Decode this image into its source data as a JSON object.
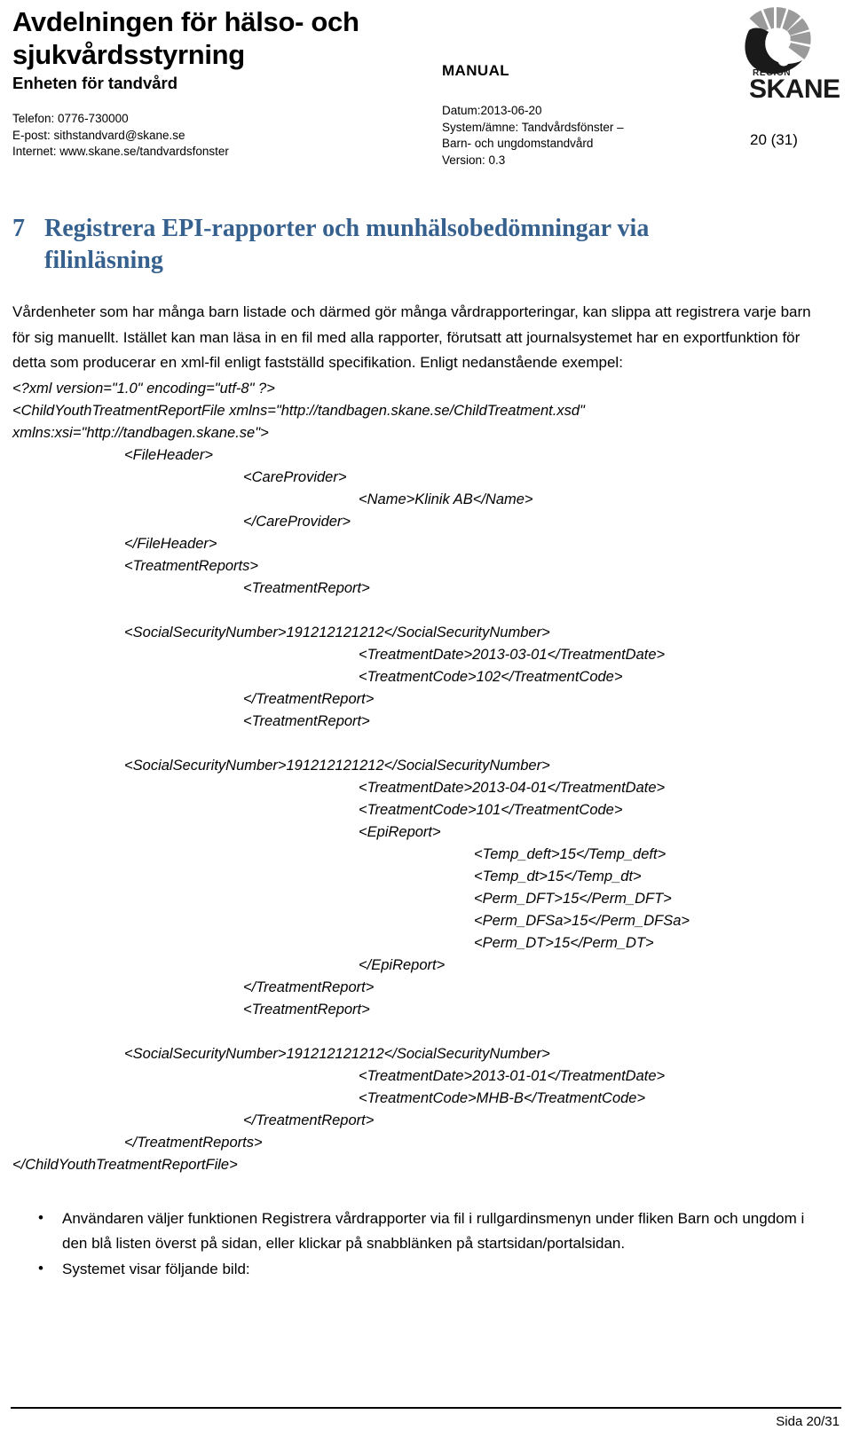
{
  "header": {
    "org_title": "Avdelningen för hälso- och sjukvårdsstyrning",
    "org_subtitle": "Enheten för tandvård",
    "contact": {
      "phone": "Telefon: 0776-730000",
      "email": "E-post: sithstandvard@skane.se",
      "internet": "Internet: www.skane.se/tandvardsfonster"
    },
    "doc_type": "MANUAL",
    "meta": {
      "date": "Datum:2013-06-20",
      "system_line1": "System/ämne: Tandvårdsfönster –",
      "system_line2": "Barn- och ungdomstandvård",
      "version": "Version: 0.3"
    },
    "page_indicator": "20 (31)",
    "logo": {
      "wordmark": "SKANE",
      "sub_wordmark": "REGION",
      "ring_color": "#9A9A9A",
      "mark_color": "#1A1A1A"
    }
  },
  "section": {
    "number": "7",
    "title": "Registrera EPI-rapporter och munhälsobedömningar via filinläsning",
    "heading_color": "#36618E",
    "paragraph": "Vårdenheter som har många barn listade och därmed gör många vårdrapporteringar, kan slippa att registrera varje barn för sig manuellt. Istället kan man läsa in en fil med alla rapporter, förutsatt att journalsystemet har en exportfunktion för detta som producerar en xml-fil enligt fastställd specifikation. Enligt nedanstående exempel:"
  },
  "xml_example": [
    {
      "indent": 0,
      "text": "<?xml version=\"1.0\" encoding=\"utf-8\" ?>"
    },
    {
      "indent": 0,
      "text": "<ChildYouthTreatmentReportFile xmlns=\"http://tandbagen.skane.se/ChildTreatment.xsd\""
    },
    {
      "indent": 0,
      "text": "xmlns:xsi=\"http://tandbagen.skane.se\">"
    },
    {
      "indent": 1,
      "text": "<FileHeader>"
    },
    {
      "indent": 2,
      "text": "<CareProvider>"
    },
    {
      "indent": 3,
      "text": "<Name>Klinik AB</Name>"
    },
    {
      "indent": 2,
      "text": "</CareProvider>"
    },
    {
      "indent": 1,
      "text": "</FileHeader>"
    },
    {
      "indent": 1,
      "text": "<TreatmentReports>"
    },
    {
      "indent": 2,
      "text": "<TreatmentReport>"
    },
    {
      "indent": 0,
      "text": ""
    },
    {
      "indent": 1,
      "text": "<SocialSecurityNumber>191212121212</SocialSecurityNumber>"
    },
    {
      "indent": 3,
      "text": "<TreatmentDate>2013-03-01</TreatmentDate>"
    },
    {
      "indent": 3,
      "text": "<TreatmentCode>102</TreatmentCode>"
    },
    {
      "indent": 2,
      "text": "</TreatmentReport>"
    },
    {
      "indent": 2,
      "text": "<TreatmentReport>"
    },
    {
      "indent": 0,
      "text": ""
    },
    {
      "indent": 1,
      "text": "<SocialSecurityNumber>191212121212</SocialSecurityNumber>"
    },
    {
      "indent": 3,
      "text": "<TreatmentDate>2013-04-01</TreatmentDate>"
    },
    {
      "indent": 3,
      "text": "<TreatmentCode>101</TreatmentCode>"
    },
    {
      "indent": 3,
      "text": "<EpiReport>"
    },
    {
      "indent": 4,
      "text": "<Temp_deft>15</Temp_deft>"
    },
    {
      "indent": 4,
      "text": "<Temp_dt>15</Temp_dt>"
    },
    {
      "indent": 4,
      "text": "<Perm_DFT>15</Perm_DFT>"
    },
    {
      "indent": 4,
      "text": "<Perm_DFSa>15</Perm_DFSa>"
    },
    {
      "indent": 4,
      "text": "<Perm_DT>15</Perm_DT>"
    },
    {
      "indent": 3,
      "text": "</EpiReport>"
    },
    {
      "indent": 2,
      "text": "</TreatmentReport>"
    },
    {
      "indent": 2,
      "text": "<TreatmentReport>"
    },
    {
      "indent": 0,
      "text": ""
    },
    {
      "indent": 1,
      "text": "<SocialSecurityNumber>191212121212</SocialSecurityNumber>"
    },
    {
      "indent": 3,
      "text": "<TreatmentDate>2013-01-01</TreatmentDate>"
    },
    {
      "indent": 3,
      "text": "<TreatmentCode>MHB-B</TreatmentCode>"
    },
    {
      "indent": 2,
      "text": "</TreatmentReport>"
    },
    {
      "indent": 1,
      "text": "</TreatmentReports>"
    },
    {
      "indent": 0,
      "text": "</ChildYouthTreatmentReportFile>"
    }
  ],
  "bullets": [
    "Användaren väljer funktionen Registrera vårdrapporter via fil i rullgardinsmenyn under fliken Barn och ungdom i den blå listen överst på sidan, eller klickar på  snabblänken på startsidan/portalsidan.",
    "Systemet visar följande bild:"
  ],
  "footer": {
    "page_label": "Sida 20/31"
  }
}
